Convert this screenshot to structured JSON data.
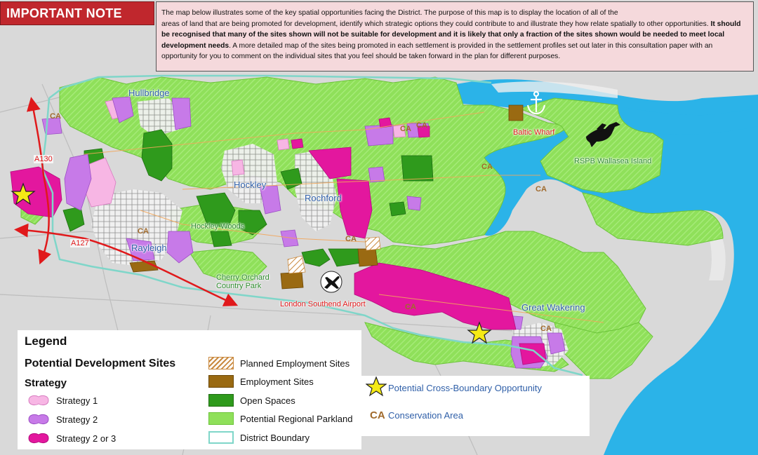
{
  "note": {
    "tag": "IMPORTANT NOTE",
    "text_1": "The map below illustrates some of the key spatial opportunities facing the District. The purpose of this map is to display the location of all of the",
    "text_2": "areas of land that are being promoted for development, identify which strategic options they could contribute to and illustrate they how relate spatially to other",
    "text_3": "opportunities.",
    "text_bold": "It should be recognised that many of the sites shown will not be suitable for development and it is likely that only a fraction of the sites shown would be needed to meet local development needs",
    "text_4": ". A more detailed map of the sites being promoted in each settlement is provided in the settlement profiles set out later in this consultation paper with an opportunity for you to comment on the individual sites that you feel should be taken forward in the plan for different purposes."
  },
  "places": {
    "hullbridge": "Hullbridge",
    "hockley": "Hockley",
    "rochford": "Rochford",
    "rayleigh": "Rayleigh",
    "great_wakering": "Great Wakering",
    "hockley_woods": "Hockley Woods",
    "cherry_orchard_1": "Cherry Orchard",
    "cherry_orchard_2": "Country Park",
    "rspb": "RSPB Wallasea Island",
    "baltic_wharf": "Baltic Wharf",
    "airport": "London Southend Airport",
    "a130": "A130",
    "a127": "A127",
    "ca": "CA"
  },
  "legend": {
    "title": "Legend",
    "subtitle": "Potential Development Sites",
    "strategy_heading": "Strategy",
    "strategy_1": "Strategy 1",
    "strategy_2": "Strategy 2",
    "strategy_2_or_3": "Strategy 2 or 3",
    "planned_employment": "Planned Employment Sites",
    "employment": "Employment Sites",
    "open_spaces": "Open Spaces",
    "regional_parkland": "Potential Regional Parkland",
    "district_boundary": "District Boundary",
    "cross_boundary": "Potential Cross-Boundary Opportunity",
    "ca_abbrev": "CA",
    "conservation_area": "Conservation Area"
  },
  "colors": {
    "water": "#2bb3e8",
    "land": "#d9d9d9",
    "parkland": "#8fe05a",
    "open_space": "#2f9a1c",
    "strategy_1": "#f7b6e4",
    "strategy_2": "#c77ae8",
    "strategy_2_or_3": "#e3179e",
    "employment": "#9a6a12",
    "boundary": "#7fd6c9",
    "note_red": "#c0272d",
    "note_bg": "#f5d9dc",
    "arrow_red": "#e0191b"
  },
  "icons": [
    "anchor-icon",
    "bird-icon",
    "airplane-icon",
    "star-icon",
    "arrow-icon"
  ]
}
